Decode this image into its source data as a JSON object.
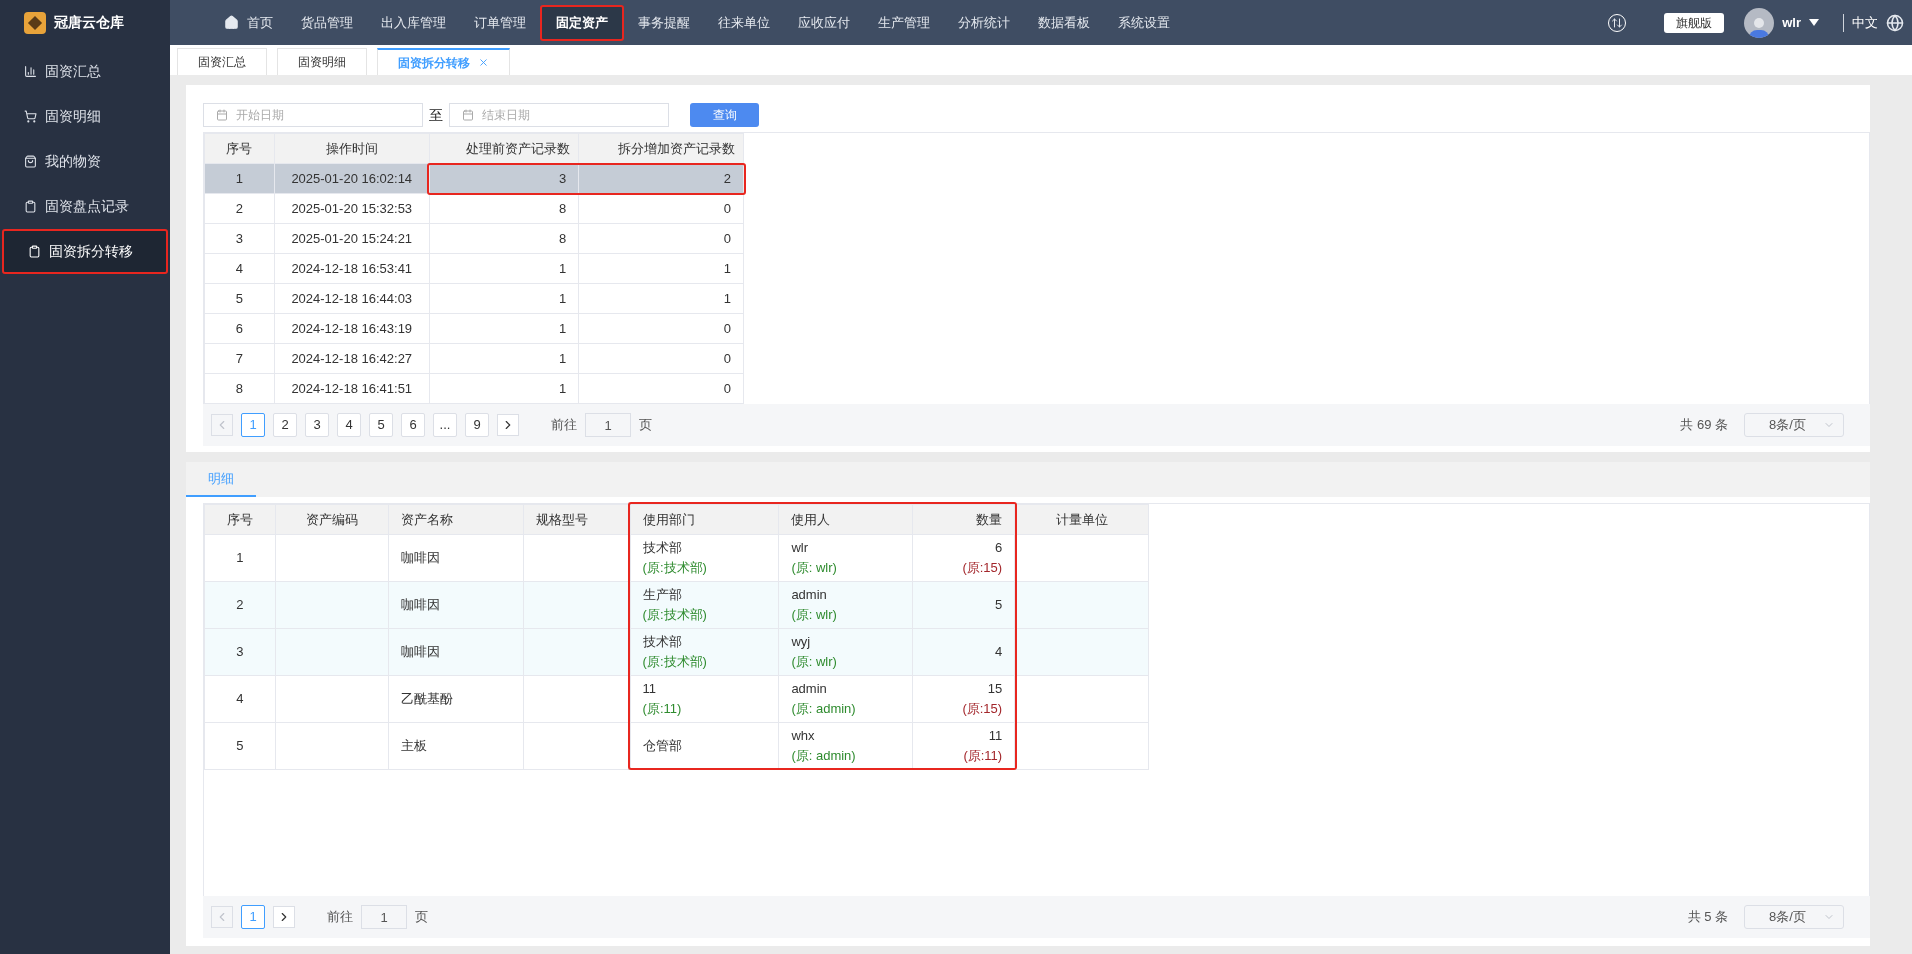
{
  "brand": {
    "name": "冠唐云仓库"
  },
  "nav": [
    {
      "label": "首页",
      "kind": "home",
      "selected": false,
      "highlighted": false
    },
    {
      "label": "货品管理",
      "kind": "plain",
      "selected": false,
      "highlighted": false
    },
    {
      "label": "出入库管理",
      "kind": "plain",
      "selected": false,
      "highlighted": false
    },
    {
      "label": "订单管理",
      "kind": "plain",
      "selected": false,
      "highlighted": false
    },
    {
      "label": "固定资产",
      "kind": "plain",
      "selected": true,
      "highlighted": true
    },
    {
      "label": "事务提醒",
      "kind": "plain",
      "selected": false,
      "highlighted": false
    },
    {
      "label": "往来单位",
      "kind": "plain",
      "selected": false,
      "highlighted": false
    },
    {
      "label": "应收应付",
      "kind": "plain",
      "selected": false,
      "highlighted": false
    },
    {
      "label": "生产管理",
      "kind": "plain",
      "selected": false,
      "highlighted": false
    },
    {
      "label": "分析统计",
      "kind": "plain",
      "selected": false,
      "highlighted": false
    },
    {
      "label": "数据看板",
      "kind": "plain",
      "selected": false,
      "highlighted": false
    },
    {
      "label": "系统设置",
      "kind": "plain",
      "selected": false,
      "highlighted": false
    }
  ],
  "header": {
    "edition": "旗舰版",
    "user": "wlr",
    "language": "中文"
  },
  "sidebar": {
    "items": [
      {
        "label": "固资汇总",
        "kind": "chart",
        "selected": false,
        "highlighted": false
      },
      {
        "label": "固资明细",
        "kind": "cart",
        "selected": false,
        "highlighted": false
      },
      {
        "label": "我的物资",
        "kind": "bag",
        "selected": false,
        "highlighted": false
      },
      {
        "label": "固资盘点记录",
        "kind": "clipboard",
        "selected": false,
        "highlighted": false
      },
      {
        "label": "固资拆分转移",
        "kind": "clipboard",
        "selected": true,
        "highlighted": true
      }
    ]
  },
  "page_tabs": [
    {
      "label": "固资汇总",
      "selected": false,
      "closable": false
    },
    {
      "label": "固资明细",
      "selected": false,
      "closable": false
    },
    {
      "label": "固资拆分转移",
      "selected": true,
      "closable": true
    }
  ],
  "filter": {
    "start_placeholder": "开始日期",
    "separator": "至",
    "end_placeholder": "结束日期",
    "button": "查询"
  },
  "records_table": {
    "columns": [
      {
        "label": "序号",
        "highlighted": false
      },
      {
        "label": "操作时间",
        "highlighted": false
      },
      {
        "label": "处理前资产记录数",
        "highlighted": true
      },
      {
        "label": "拆分增加资产记录数",
        "highlighted": true
      }
    ],
    "rows": [
      {
        "selected": true,
        "highlighted": true,
        "cells": [
          "1",
          "2025-01-20 16:02:14",
          "3",
          "2"
        ]
      },
      {
        "selected": false,
        "highlighted": false,
        "cells": [
          "2",
          "2025-01-20 15:32:53",
          "8",
          "0"
        ]
      },
      {
        "selected": false,
        "highlighted": false,
        "cells": [
          "3",
          "2025-01-20 15:24:21",
          "8",
          "0"
        ]
      },
      {
        "selected": false,
        "highlighted": false,
        "cells": [
          "4",
          "2024-12-18 16:53:41",
          "1",
          "1"
        ]
      },
      {
        "selected": false,
        "highlighted": false,
        "cells": [
          "5",
          "2024-12-18 16:44:03",
          "1",
          "1"
        ]
      },
      {
        "selected": false,
        "highlighted": false,
        "cells": [
          "6",
          "2024-12-18 16:43:19",
          "1",
          "0"
        ]
      },
      {
        "selected": false,
        "highlighted": false,
        "cells": [
          "7",
          "2024-12-18 16:42:27",
          "1",
          "0"
        ]
      },
      {
        "selected": false,
        "highlighted": false,
        "cells": [
          "8",
          "2024-12-18 16:41:51",
          "1",
          "0"
        ]
      }
    ],
    "pagination": {
      "pages": [
        {
          "label": "1",
          "selected": true
        },
        {
          "label": "2",
          "selected": false
        },
        {
          "label": "3",
          "selected": false
        },
        {
          "label": "4",
          "selected": false
        },
        {
          "label": "5",
          "selected": false
        },
        {
          "label": "6",
          "selected": false
        },
        {
          "label": "...",
          "selected": false
        },
        {
          "label": "9",
          "selected": false
        }
      ],
      "goto_label": "前往",
      "goto_value": "1",
      "goto_suffix": "页",
      "total": "共 69 条",
      "page_size": "8条/页"
    }
  },
  "detail_tabs": [
    {
      "label": "明细",
      "selected": true
    }
  ],
  "detail_table": {
    "columns": [
      {
        "label": "序号",
        "highlighted": false
      },
      {
        "label": "资产编码",
        "highlighted": false
      },
      {
        "label": "资产名称",
        "highlighted": false
      },
      {
        "label": "规格型号",
        "highlighted": false
      },
      {
        "label": "使用部门",
        "highlighted": true
      },
      {
        "label": "使用人",
        "highlighted": true
      },
      {
        "label": "数量",
        "highlighted": true
      },
      {
        "label": "计量单位",
        "highlighted": false
      }
    ],
    "rows": [
      {
        "selected": false,
        "cells": [
          {
            "value": "1"
          },
          {},
          {
            "value": "咖啡因"
          },
          {},
          {
            "value": "技术部",
            "original": "(原:技术部)"
          },
          {
            "value": "wlr",
            "original": "(原: wlr)"
          },
          {
            "value": "6",
            "original": "(原:15)"
          },
          {}
        ]
      },
      {
        "selected": true,
        "cells": [
          {
            "value": "2"
          },
          {},
          {
            "value": "咖啡因"
          },
          {},
          {
            "value": "生产部",
            "original": "(原:技术部)"
          },
          {
            "value": "admin",
            "original": "(原: wlr)"
          },
          {
            "value": "5"
          },
          {}
        ]
      },
      {
        "selected": true,
        "cells": [
          {
            "value": "3"
          },
          {},
          {
            "value": "咖啡因"
          },
          {},
          {
            "value": "技术部",
            "original": "(原:技术部)"
          },
          {
            "value": "wyj",
            "original": "(原: wlr)"
          },
          {
            "value": "4"
          },
          {}
        ]
      },
      {
        "selected": false,
        "cells": [
          {
            "value": "4"
          },
          {},
          {
            "value": "乙酰基酚"
          },
          {},
          {
            "value": "11",
            "original": "(原:11)"
          },
          {
            "value": "admin",
            "original": "(原: admin)"
          },
          {
            "value": "15",
            "original": "(原:15)"
          },
          {}
        ]
      },
      {
        "selected": false,
        "cells": [
          {
            "value": "5"
          },
          {},
          {
            "value": "主板"
          },
          {},
          {
            "value": "仓管部"
          },
          {
            "value": "whx",
            "original": "(原: admin)"
          },
          {
            "value": "11",
            "original": "(原:11)"
          },
          {}
        ]
      }
    ],
    "pagination": {
      "pages": [
        {
          "label": "1",
          "selected": true
        }
      ],
      "goto_label": "前往",
      "goto_value": "1",
      "goto_suffix": "页",
      "total": "共 5 条",
      "page_size": "8条/页"
    }
  }
}
